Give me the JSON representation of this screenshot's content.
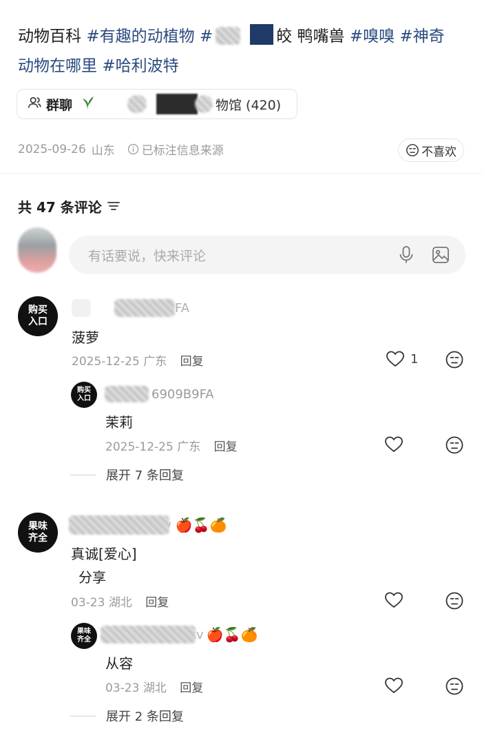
{
  "post": {
    "tags_line1_a": "动物百科",
    "tags_line1_b": "#有趣的动植物",
    "tags_line1_c": "#",
    "tags_line1_d": "皎",
    "tags_line1_e": "鸭嘴兽",
    "tags_line1_f": "#嗅嗅",
    "tags_line1_g": "#神奇",
    "tags_line2_a": "动物在哪里",
    "tags_line2_b": "#哈利波特",
    "group_label": "群聊",
    "group_name": "物馆 (420)",
    "date": "2025-09-26",
    "location": "山东",
    "source_note": "已标注信息来源",
    "dislike_label": "不喜欢"
  },
  "comments_header": {
    "count_text": "共 47 条评论"
  },
  "comment_input": {
    "placeholder": "有话要说，快来评论"
  },
  "comments": [
    {
      "avatar_text_1": "购买",
      "avatar_text_2": "入口",
      "username_suffix": "FA",
      "text": "菠萝",
      "date": "2025-12-25",
      "location": "广东",
      "reply_label": "回复",
      "likes": "1",
      "replies": [
        {
          "avatar_text_1": "购买",
          "avatar_text_2": "入口",
          "username_suffix": "6909B9FA",
          "text": "茉莉",
          "date": "2025-12-25",
          "location": "广东",
          "reply_label": "回复"
        }
      ],
      "expand_label": "展开 7 条回复"
    },
    {
      "avatar_text_1": "果味",
      "avatar_text_2": "齐全",
      "username_suffix": "v",
      "username_emojis": "🍎🍒🍊",
      "text_line1": "真诚[爱心]",
      "text_line2": "分享",
      "date": "03-23",
      "location": "湖北",
      "reply_label": "回复",
      "replies": [
        {
          "avatar_text_1": "果味",
          "avatar_text_2": "齐全",
          "username_suffix": "tv",
          "username_emojis": "🍎🍒🍊",
          "text": "从容",
          "date": "03-23",
          "location": "湖北",
          "reply_label": "回复"
        }
      ],
      "expand_label": "展开 2 条回复"
    }
  ],
  "icons": {
    "group": "people-icon",
    "info": "info-icon",
    "dislike": "dislike-face-icon",
    "sort": "sort-icon",
    "mic": "microphone-icon",
    "image": "image-icon",
    "like": "heart-icon",
    "face": "meh-face-icon"
  },
  "colors": {
    "tag": "#2a4a7f",
    "muted": "#9a9a9a",
    "avatar_bg": "#111111"
  }
}
